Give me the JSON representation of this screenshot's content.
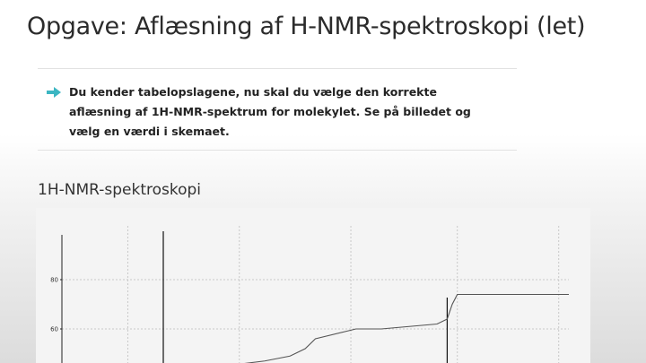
{
  "page": {
    "title": "Opgave: Aflæsning af H-NMR-spektroskopi (let)"
  },
  "instruction": {
    "icon": "arrow-right-icon",
    "icon_color": "#3cb6c2",
    "text": "Du kender tabelopslagene, nu skal du vælge den korrekte aflæsning af 1H-NMR-spektrum for molekylet. Se på billedet og vælg en værdi i skemaet."
  },
  "spectrum_section": {
    "heading": "1H-NMR-spektroskopi"
  },
  "chart_data": {
    "type": "line",
    "y_ticks": [
      60,
      80
    ],
    "ylim": [
      40,
      90
    ],
    "grid": true,
    "series": [
      {
        "x": [
          0.2,
          0.34,
          0.36,
          0.4,
          0.45,
          0.48,
          0.5,
          0.56,
          0.58,
          0.59,
          0.63,
          0.74,
          0.76,
          0.77,
          0.78,
          1.0
        ],
        "y": [
          45,
          45,
          46,
          47,
          49,
          52,
          56,
          59,
          60,
          60,
          60,
          62,
          64,
          70,
          74,
          74
        ]
      }
    ]
  }
}
